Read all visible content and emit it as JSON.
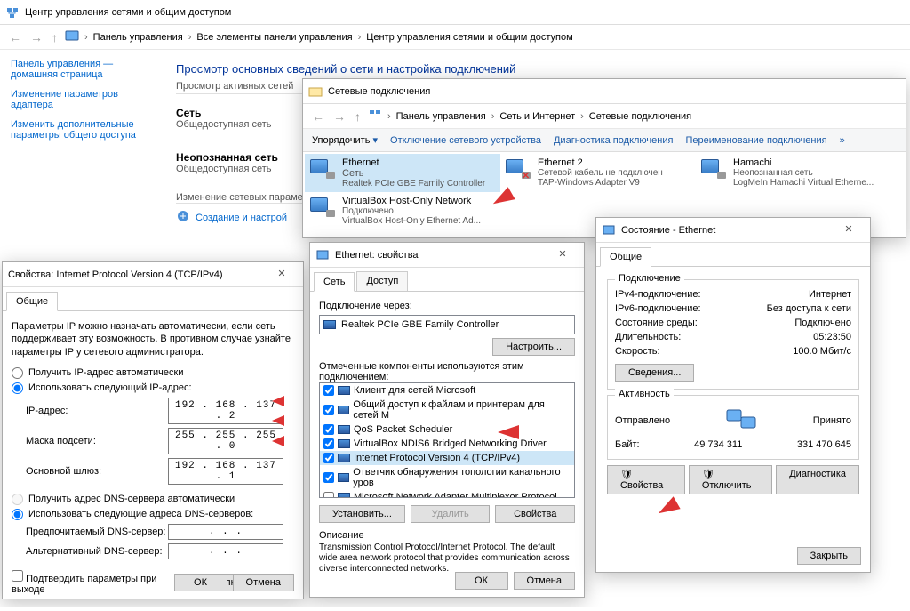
{
  "mainWin": {
    "title": "Центр управления сетями и общим доступом",
    "breadcrumbs": [
      "Панель управления",
      "Все элементы панели управления",
      "Центр управления сетями и общим доступом"
    ],
    "sidebar": {
      "home": "Панель управления — домашняя страница",
      "links": [
        "Изменение параметров адаптера",
        "Изменить дополнительные параметры общего доступа"
      ]
    },
    "pageTitle": "Просмотр основных сведений о сети и настройка подключений",
    "activeNetworks": "Просмотр активных сетей",
    "net1": {
      "name": "Сеть",
      "type": "Общедоступная сеть"
    },
    "net2": {
      "name": "Неопознанная сеть",
      "type": "Общедоступная сеть"
    },
    "changeSettings": "Изменение сетевых параметров",
    "createLink": "Создание и настрой"
  },
  "connWin": {
    "title": "Сетевые подключения",
    "breadcrumbs": [
      "Панель управления",
      "Сеть и Интернет",
      "Сетевые подключения"
    ],
    "toolbar": {
      "organize": "Упорядочить",
      "disable": "Отключение сетевого устройства",
      "diagnose": "Диагностика подключения",
      "rename": "Переименование подключения"
    },
    "items": [
      {
        "name": "Ethernet",
        "status": "Сеть",
        "device": "Realtek PCIe GBE Family Controller"
      },
      {
        "name": "Ethernet 2",
        "status": "Сетевой кабель не подключен",
        "device": "TAP-Windows Adapter V9"
      },
      {
        "name": "Hamachi",
        "status": "Неопознанная сеть",
        "device": "LogMeIn Hamachi Virtual Etherne..."
      },
      {
        "name": "VirtualBox Host-Only Network",
        "status": "Подключено",
        "device": "VirtualBox Host-Only Ethernet Ad..."
      }
    ]
  },
  "ipv4Win": {
    "title": "Свойства: Internet Protocol Version 4 (TCP/IPv4)",
    "tab": "Общие",
    "intro": "Параметры IP можно назначать автоматически, если сеть поддерживает эту возможность. В противном случае узнайте параметры IP у сетевого администратора.",
    "radioAuto": "Получить IP-адрес автоматически",
    "radioManual": "Использовать следующий IP-адрес:",
    "labels": {
      "ip": "IP-адрес:",
      "mask": "Маска подсети:",
      "gw": "Основной шлюз:"
    },
    "values": {
      "ip": "192 . 168 . 137 .  2",
      "mask": "255 . 255 . 255 .  0",
      "gw": "192 . 168 . 137 .  1"
    },
    "dnsAuto": "Получить адрес DNS-сервера автоматически",
    "dnsManual": "Использовать следующие адреса DNS-серверов:",
    "dnsLabels": {
      "pref": "Предпочитаемый DNS-сервер:",
      "alt": "Альтернативный DNS-сервер:"
    },
    "dnsValues": {
      "pref": ".        .        .",
      "alt": ".        .        ."
    },
    "confirmExit": "Подтвердить параметры при выходе",
    "advanced": "Дополнительно...",
    "ok": "ОК",
    "cancel": "Отмена"
  },
  "propWin": {
    "title": "Ethernet: свойства",
    "tabs": [
      "Сеть",
      "Доступ"
    ],
    "connectVia": "Подключение через:",
    "adapter": "Realtek PCIe GBE Family Controller",
    "configure": "Настроить...",
    "componentsLabel": "Отмеченные компоненты используются этим подключением:",
    "components": [
      "Клиент для сетей Microsoft",
      "Общий доступ к файлам и принтерам для сетей M",
      "QoS Packet Scheduler",
      "VirtualBox NDIS6 Bridged Networking Driver",
      "Internet Protocol Version 4 (TCP/IPv4)",
      "Ответчик обнаружения топологии канального уров",
      "Microsoft Network Adapter Multiplexor Protocol"
    ],
    "install": "Установить...",
    "remove": "Удалить",
    "props": "Свойства",
    "descLabel": "Описание",
    "desc": "Transmission Control Protocol/Internet Protocol. The default wide area network protocol that provides communication across diverse interconnected networks.",
    "ok": "ОК",
    "cancel": "Отмена"
  },
  "statusWin": {
    "title": "Состояние - Ethernet",
    "tab": "Общие",
    "groupConn": "Подключение",
    "rows": {
      "ipv4": {
        "k": "IPv4-подключение:",
        "v": "Интернет"
      },
      "ipv6": {
        "k": "IPv6-подключение:",
        "v": "Без доступа к сети"
      },
      "media": {
        "k": "Состояние среды:",
        "v": "Подключено"
      },
      "dur": {
        "k": "Длительность:",
        "v": "05:23:50"
      },
      "speed": {
        "k": "Скорость:",
        "v": "100.0 Мбит/с"
      }
    },
    "details": "Сведения...",
    "groupAct": "Активность",
    "sent": "Отправлено",
    "recv": "Принято",
    "bytes": "Байт:",
    "bytesSent": "49 734 311",
    "bytesRecv": "331 470 645",
    "btnProps": "Свойства",
    "btnDisable": "Отключить",
    "btnDiag": "Диагностика",
    "btnClose": "Закрыть"
  }
}
